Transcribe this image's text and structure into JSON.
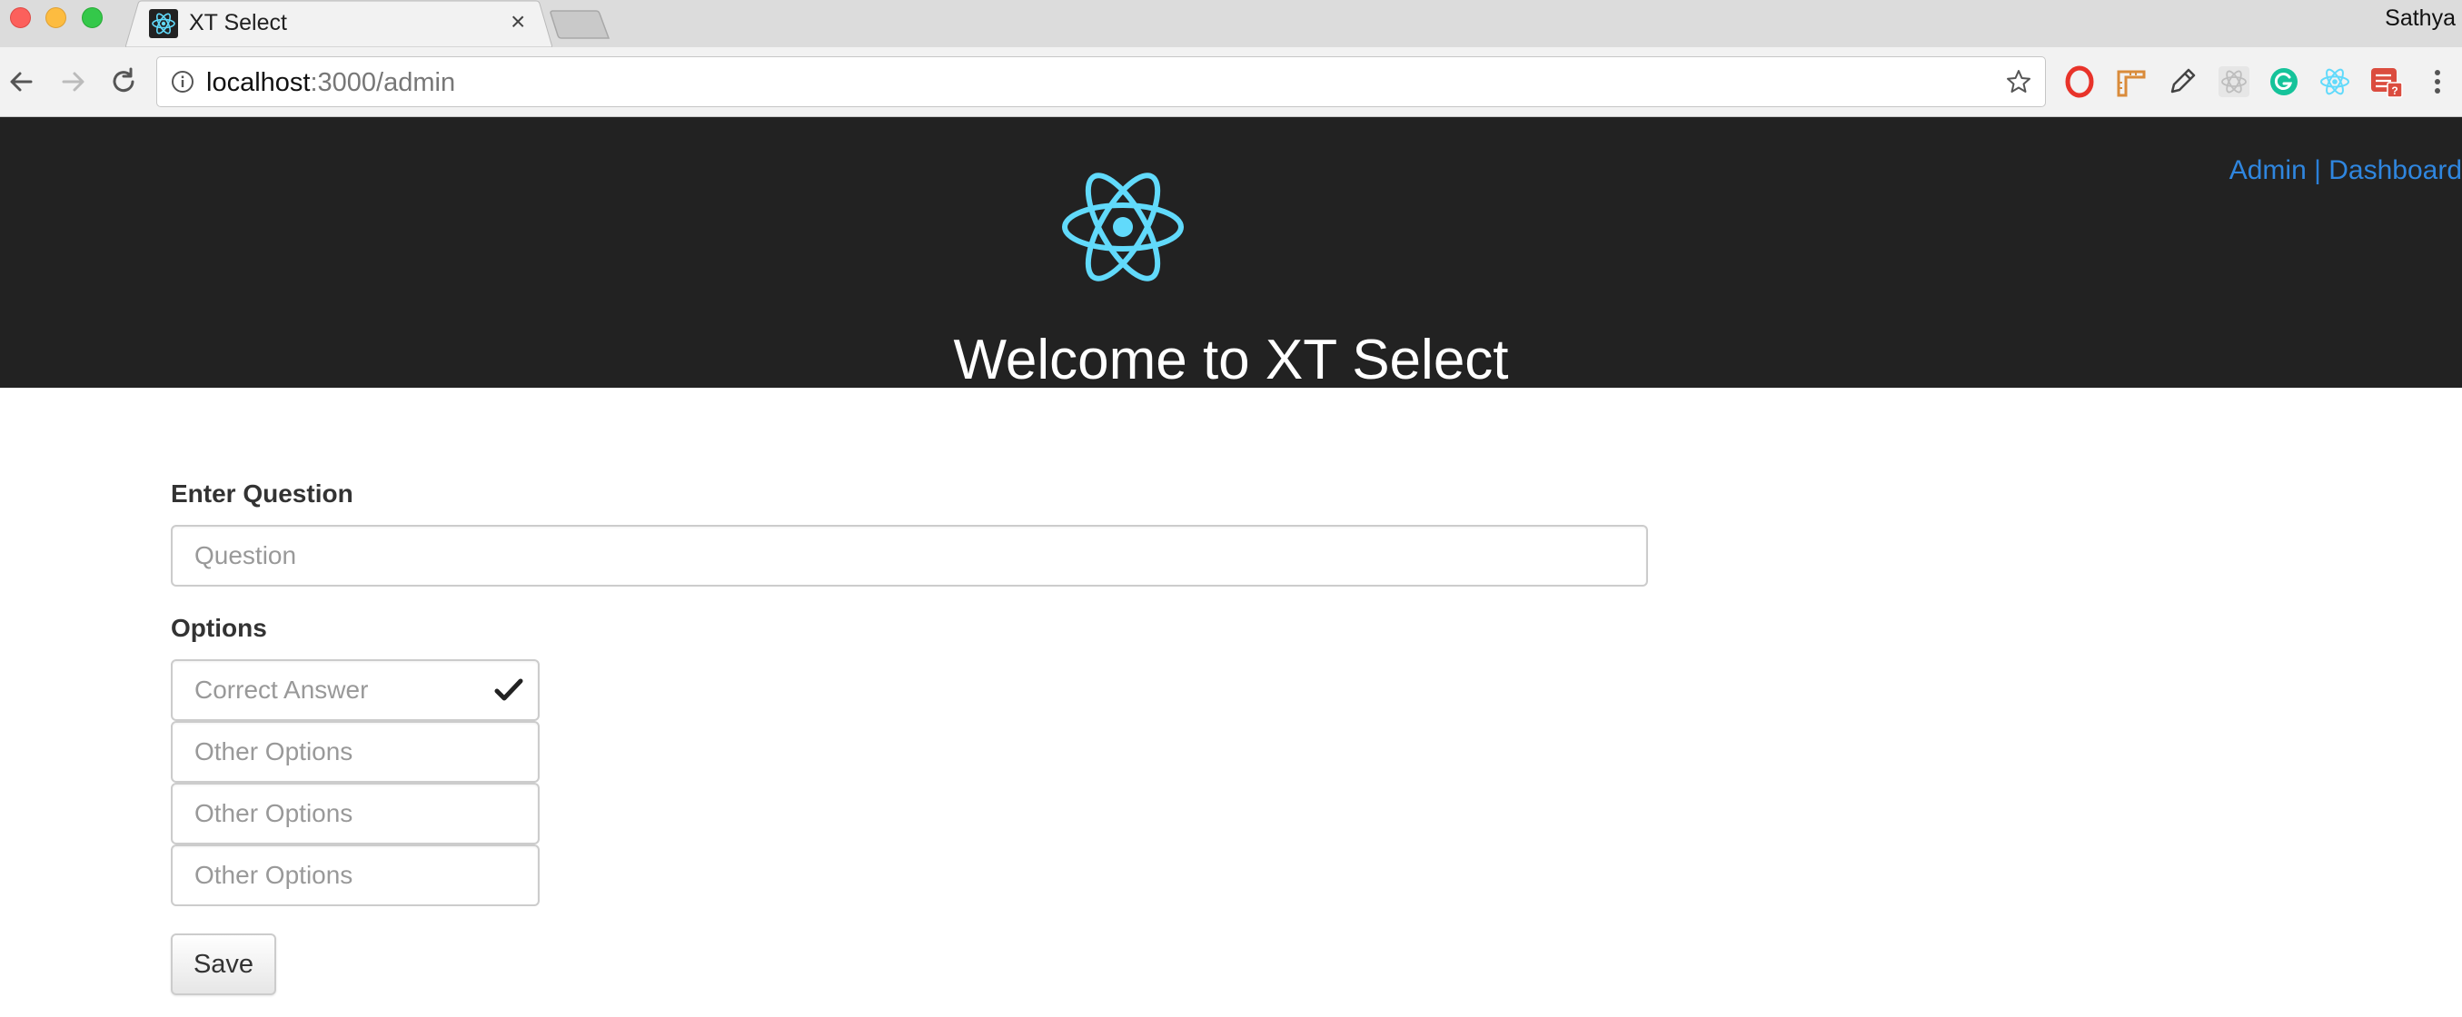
{
  "browser": {
    "tab": {
      "title": "XT Select",
      "close": "×"
    },
    "profile_name": "Sathya",
    "address_bar": {
      "host": "localhost",
      "path": ":3000/admin"
    },
    "extensions": [
      "opera-icon",
      "ruler-icon",
      "pencil-icon",
      "react-gray-icon",
      "grammarly-icon",
      "react-devtools-icon",
      "todoist-icon"
    ]
  },
  "header": {
    "title": "Welcome to XT Select",
    "nav": {
      "admin": "Admin",
      "separator": " | ",
      "dashboard": "Dashboard"
    },
    "logo_color": "#61dafb",
    "background": "#222222"
  },
  "form": {
    "question_label": "Enter Question",
    "question_placeholder": "Question",
    "options_label": "Options",
    "options": [
      {
        "placeholder": "Correct Answer",
        "correct": true
      },
      {
        "placeholder": "Other Options",
        "correct": false
      },
      {
        "placeholder": "Other Options",
        "correct": false
      },
      {
        "placeholder": "Other Options",
        "correct": false
      }
    ],
    "save_label": "Save"
  },
  "colors": {
    "link": "#2f86df",
    "accent": "#61dafb"
  }
}
